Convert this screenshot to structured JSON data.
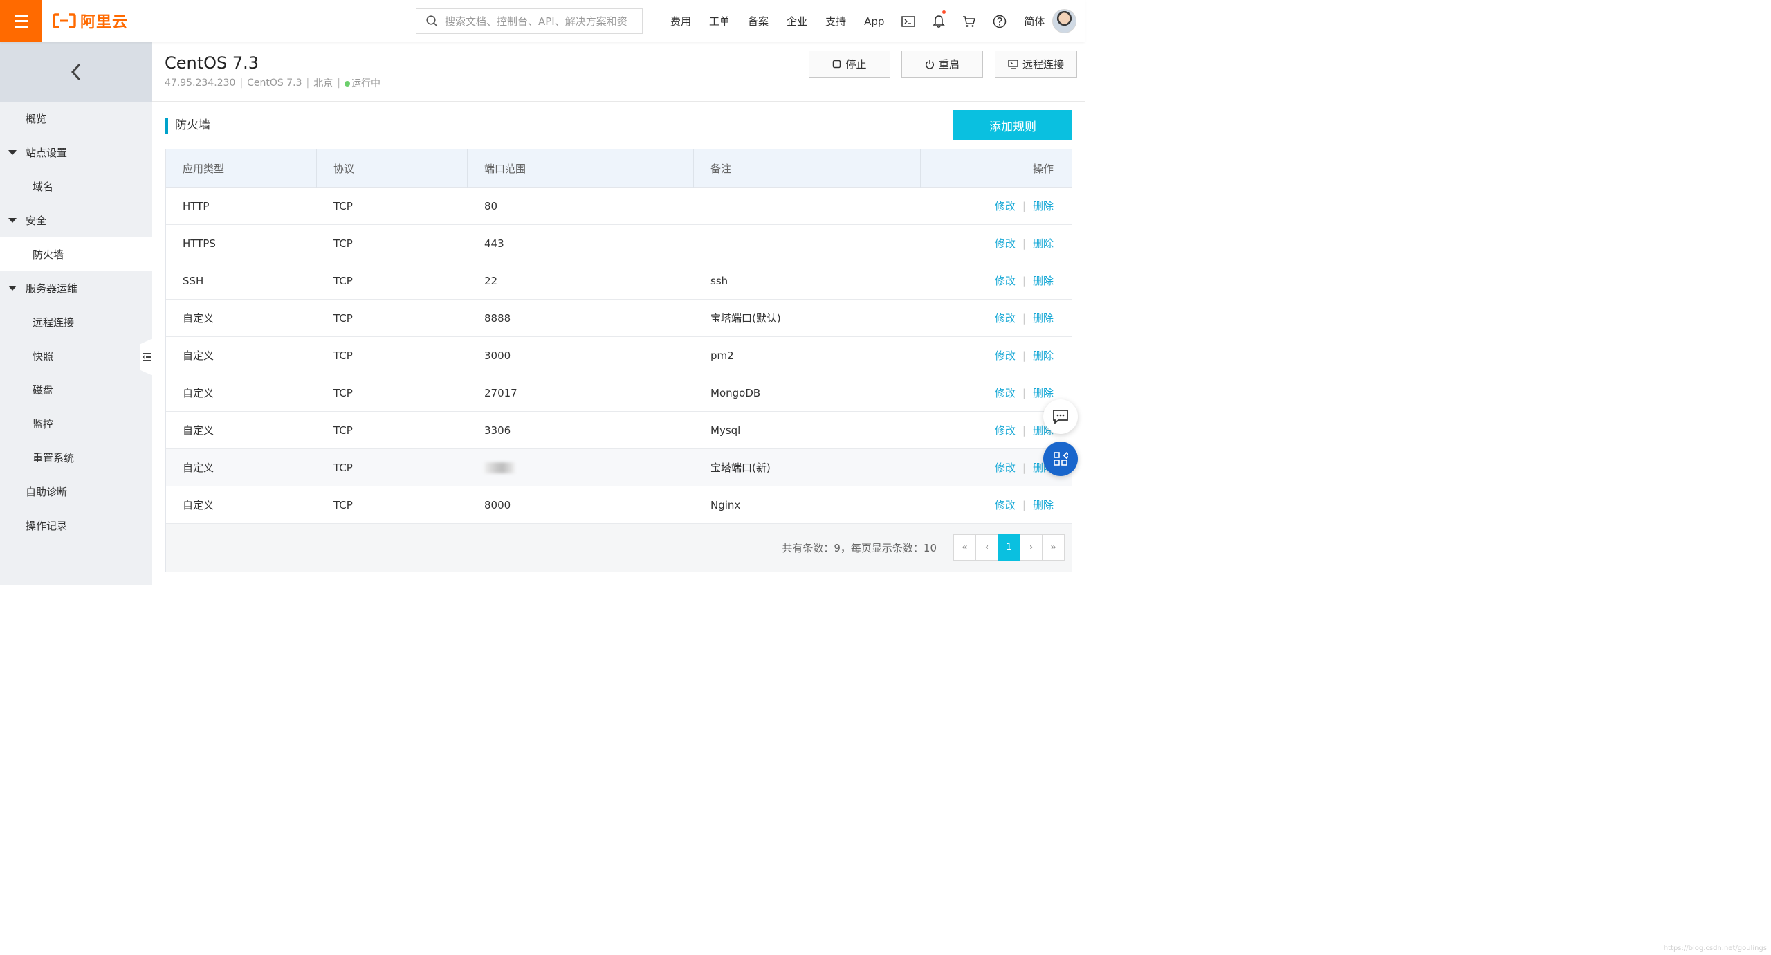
{
  "topbar": {
    "menu_icon": "hamburger-icon",
    "logo_text": "阿里云",
    "brand_color": "#ff6a00",
    "search_placeholder": "搜索文档、控制台、API、解决方案和资",
    "nav": [
      "费用",
      "工单",
      "备案",
      "企业",
      "支持",
      "App"
    ],
    "lang": "简体",
    "icons": [
      "terminal-icon",
      "bell-icon",
      "cart-icon",
      "help-icon"
    ]
  },
  "sidebar": {
    "back_icon": "chevron-left-icon",
    "items": [
      {
        "label": "概览",
        "level": 1,
        "caret": false,
        "active": false
      },
      {
        "label": "站点设置",
        "level": 1,
        "caret": true,
        "active": false
      },
      {
        "label": "域名",
        "level": 2,
        "caret": false,
        "active": false
      },
      {
        "label": "安全",
        "level": 1,
        "caret": true,
        "active": false
      },
      {
        "label": "防火墙",
        "level": 2,
        "caret": false,
        "active": true
      },
      {
        "label": "服务器运维",
        "level": 1,
        "caret": true,
        "active": false
      },
      {
        "label": "远程连接",
        "level": 2,
        "caret": false,
        "active": false
      },
      {
        "label": "快照",
        "level": 2,
        "caret": false,
        "active": false
      },
      {
        "label": "磁盘",
        "level": 2,
        "caret": false,
        "active": false
      },
      {
        "label": "监控",
        "level": 2,
        "caret": false,
        "active": false
      },
      {
        "label": "重置系统",
        "level": 2,
        "caret": false,
        "active": false
      },
      {
        "label": "自助诊断",
        "level": 1,
        "caret": false,
        "active": false
      },
      {
        "label": "操作记录",
        "level": 1,
        "caret": false,
        "active": false
      }
    ]
  },
  "instance": {
    "title": "CentOS 7.3",
    "ip": "47.95.234.230",
    "os": "CentOS 7.3",
    "region": "北京",
    "status": "运行中",
    "status_color": "#6ccf6c",
    "buttons": {
      "stop": "停止",
      "restart": "重启",
      "remote": "远程连接"
    }
  },
  "firewall": {
    "title": "防火墙",
    "add_label": "添加规则",
    "accent_color": "#0ac0e0",
    "columns": [
      "应用类型",
      "协议",
      "端口范围",
      "备注",
      "操作"
    ],
    "rows": [
      {
        "app": "HTTP",
        "protocol": "TCP",
        "port": "80",
        "note": ""
      },
      {
        "app": "HTTPS",
        "protocol": "TCP",
        "port": "443",
        "note": ""
      },
      {
        "app": "SSH",
        "protocol": "TCP",
        "port": "22",
        "note": "ssh"
      },
      {
        "app": "自定义",
        "protocol": "TCP",
        "port": "8888",
        "note": "宝塔端口(默认)"
      },
      {
        "app": "自定义",
        "protocol": "TCP",
        "port": "3000",
        "note": "pm2"
      },
      {
        "app": "自定义",
        "protocol": "TCP",
        "port": "27017",
        "note": "MongoDB"
      },
      {
        "app": "自定义",
        "protocol": "TCP",
        "port": "3306",
        "note": "Mysql"
      },
      {
        "app": "自定义",
        "protocol": "TCP",
        "port": "",
        "note": "宝塔端口(新)",
        "port_blurred": true
      },
      {
        "app": "自定义",
        "protocol": "TCP",
        "port": "8000",
        "note": "Nginx"
      }
    ],
    "edit_label": "修改",
    "delete_label": "删除",
    "footer_text": "共有条数：9，每页显示条数：10",
    "pagination": {
      "first": "«",
      "prev": "‹",
      "current": "1",
      "next": "›",
      "last": "»"
    }
  },
  "watermark": "https://blog.csdn.net/goulings",
  "floating": [
    "chat-icon",
    "apps-icon"
  ]
}
